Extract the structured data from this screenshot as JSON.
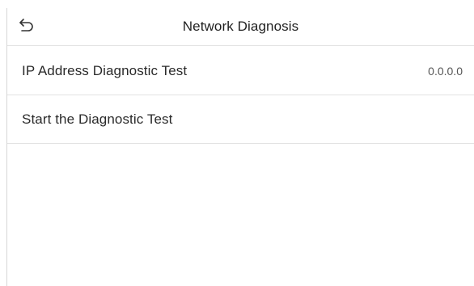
{
  "header": {
    "title": "Network Diagnosis",
    "back_icon": "back-arrow-icon"
  },
  "items": [
    {
      "label": "IP Address Diagnostic Test",
      "value": "0.0.0.0"
    },
    {
      "label": "Start the Diagnostic Test"
    }
  ]
}
